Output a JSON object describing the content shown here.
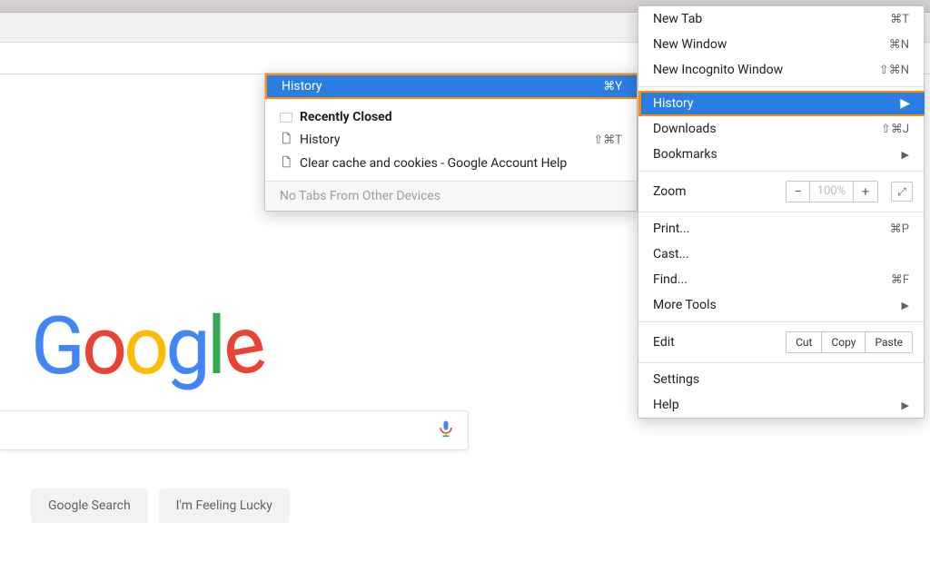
{
  "menu": {
    "new_tab": {
      "label": "New Tab",
      "shortcut": "⌘T"
    },
    "new_window": {
      "label": "New Window",
      "shortcut": "⌘N"
    },
    "new_incognito": {
      "label": "New Incognito Window",
      "shortcut": "⇧⌘N"
    },
    "history": {
      "label": "History"
    },
    "downloads": {
      "label": "Downloads",
      "shortcut": "⇧⌘J"
    },
    "bookmarks": {
      "label": "Bookmarks"
    },
    "zoom_label": "Zoom",
    "zoom_pct": "100%",
    "print": {
      "label": "Print...",
      "shortcut": "⌘P"
    },
    "cast": {
      "label": "Cast..."
    },
    "find": {
      "label": "Find...",
      "shortcut": "⌘F"
    },
    "more_tools": {
      "label": "More Tools"
    },
    "edit_label": "Edit",
    "cut": "Cut",
    "copy": "Copy",
    "paste": "Paste",
    "settings": {
      "label": "Settings"
    },
    "help": {
      "label": "Help"
    }
  },
  "submenu": {
    "history": {
      "label": "History",
      "shortcut": "⌘Y"
    },
    "recently_closed_heading": "Recently Closed",
    "items": [
      {
        "label": "History",
        "shortcut": "⇧⌘T"
      },
      {
        "label": "Clear cache and cookies - Google Account Help",
        "shortcut": ""
      }
    ],
    "footer": "No Tabs From Other Devices"
  },
  "google": {
    "search_btn": "Google Search",
    "lucky_btn": "I'm Feeling Lucky"
  }
}
